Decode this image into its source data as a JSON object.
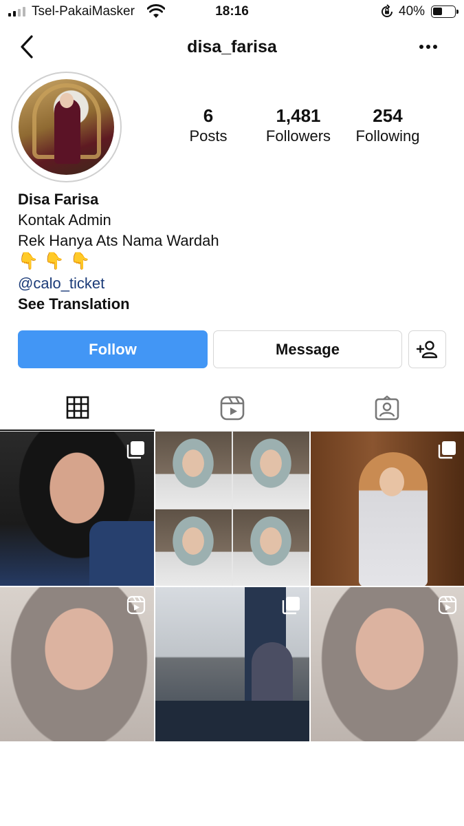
{
  "status_bar": {
    "carrier": "Tsel-PakaiMasker",
    "time": "18:16",
    "battery_percent": "40%",
    "battery_level": 0.4,
    "signal_bars": 2
  },
  "header": {
    "username": "disa_farisa",
    "icons": [
      "chevron-left-icon",
      "more-horizontal-icon"
    ]
  },
  "profile": {
    "stats": {
      "posts": {
        "value": "6",
        "label": "Posts"
      },
      "followers": {
        "value": "1,481",
        "label": "Followers"
      },
      "following": {
        "value": "254",
        "label": "Following"
      }
    },
    "bio": {
      "name": "Disa Farisa",
      "line1": "Kontak Admin",
      "line2": "Rek Hanya Ats Nama Wardah",
      "emoji": "👇",
      "emoji_count": 3,
      "link": "@calo_ticket",
      "translate": "See Translation"
    }
  },
  "actions": {
    "follow": "Follow",
    "message": "Message",
    "add_user_icon": "add-user-icon"
  },
  "colors": {
    "follow_button": "#4296f5",
    "link": "#1b3b78"
  },
  "tabs": [
    {
      "icon": "grid-icon",
      "active": true
    },
    {
      "icon": "reels-icon",
      "active": false
    },
    {
      "icon": "tagged-icon",
      "active": false
    }
  ],
  "posts": [
    {
      "badge": "carousel-icon"
    },
    {
      "badge": null
    },
    {
      "badge": "carousel-icon"
    },
    {
      "badge": "reels-icon"
    },
    {
      "badge": "carousel-icon"
    },
    {
      "badge": "reels-icon"
    }
  ]
}
